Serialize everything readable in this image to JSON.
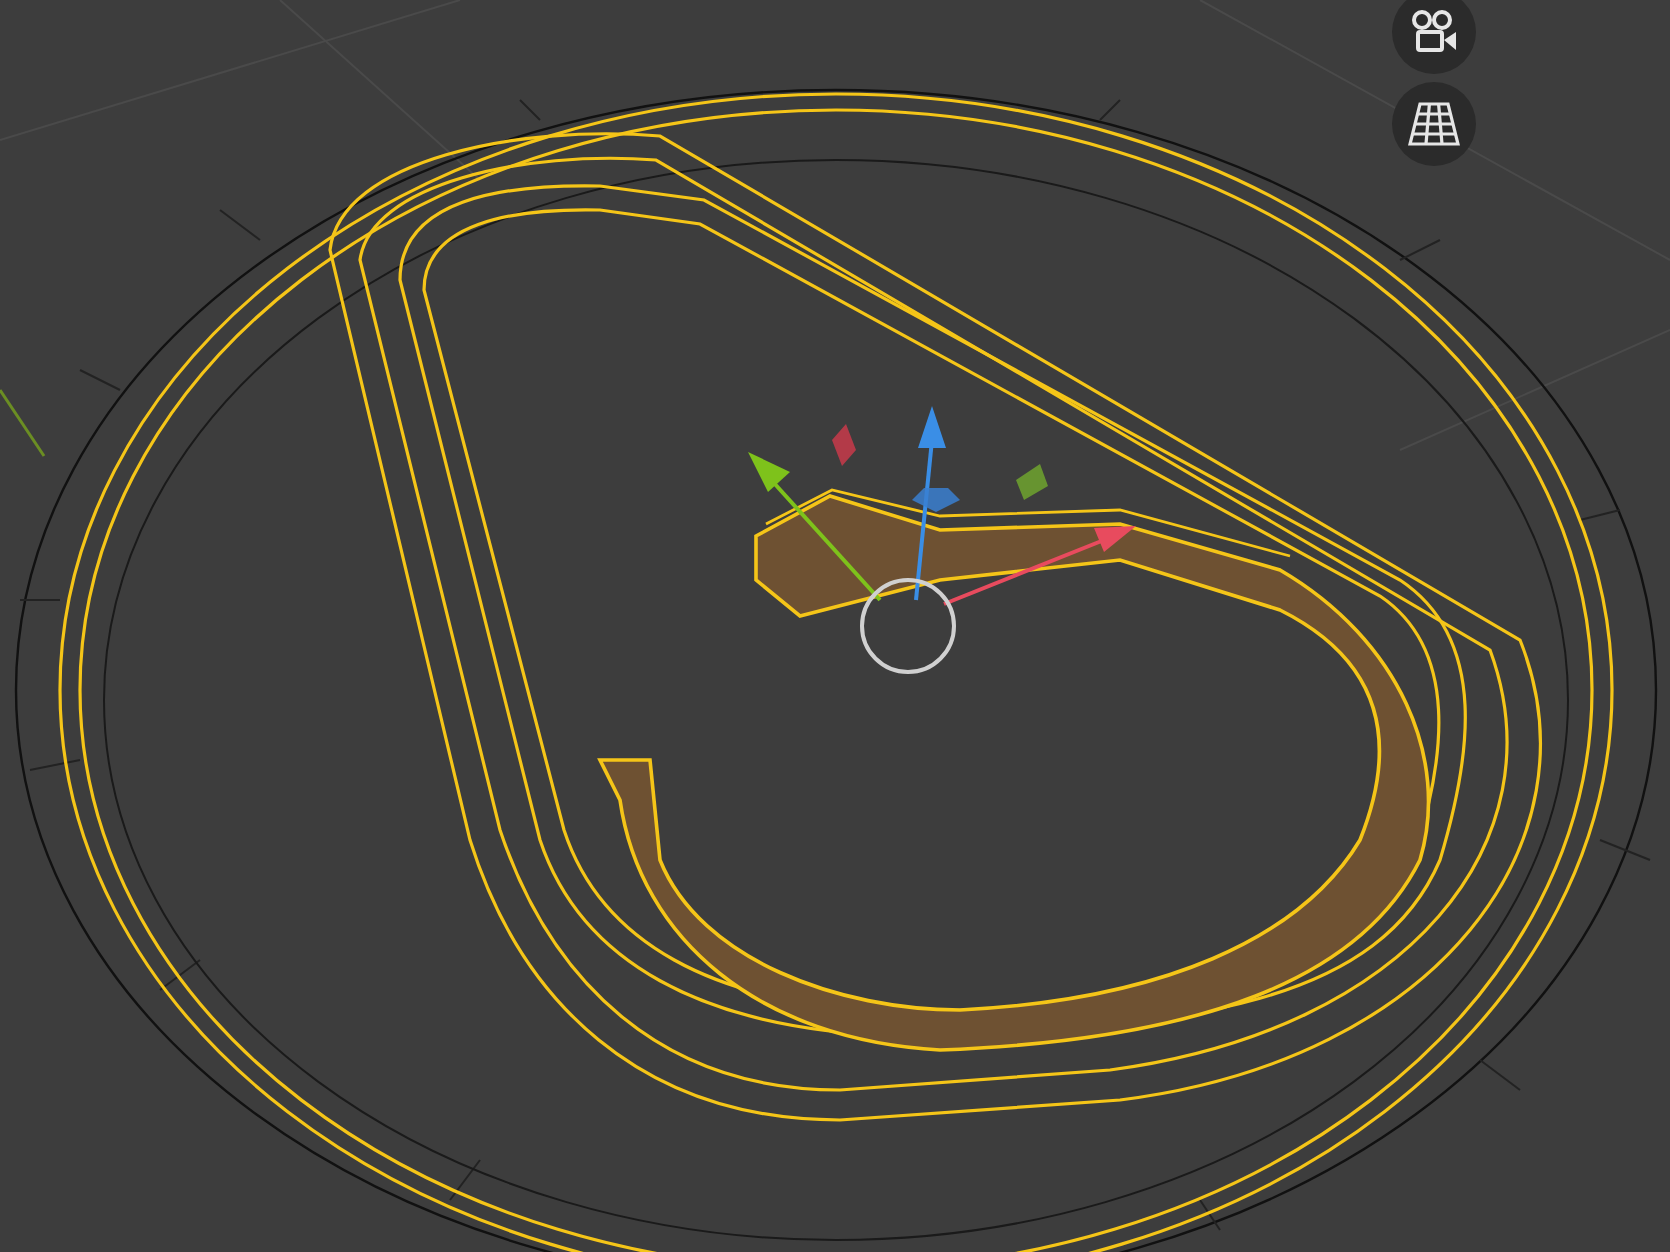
{
  "viewport_buttons": [
    {
      "kind": "camera"
    },
    {
      "kind": "grid"
    }
  ]
}
